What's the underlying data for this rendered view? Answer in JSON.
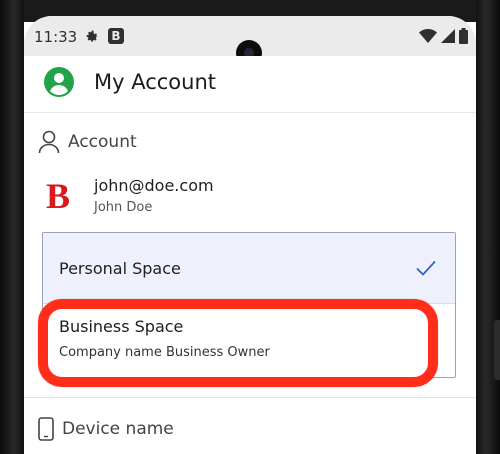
{
  "status_bar": {
    "time": "11:33",
    "icons": [
      "gear-icon",
      "b-notification-icon",
      "wifi-icon",
      "signal-icon",
      "battery-icon"
    ],
    "b_label": "B"
  },
  "app_bar": {
    "title": "My Account",
    "icon": "account-circle-icon",
    "accent_color": "#22a34a"
  },
  "account_section": {
    "header": "Account",
    "email": "john@doe.com",
    "name": "John Doe",
    "brand_letter": "B",
    "brand_color": "#d71920"
  },
  "spaces": [
    {
      "name": "Personal Space",
      "selected": true
    },
    {
      "name": "Business Space",
      "description": "Company name Business Owner",
      "selected": false
    }
  ],
  "device_section": {
    "header": "Device name"
  },
  "colors": {
    "selected_bg": "#eef1fb",
    "check_color": "#2f5fd6",
    "highlight": "#ff2d1a"
  }
}
